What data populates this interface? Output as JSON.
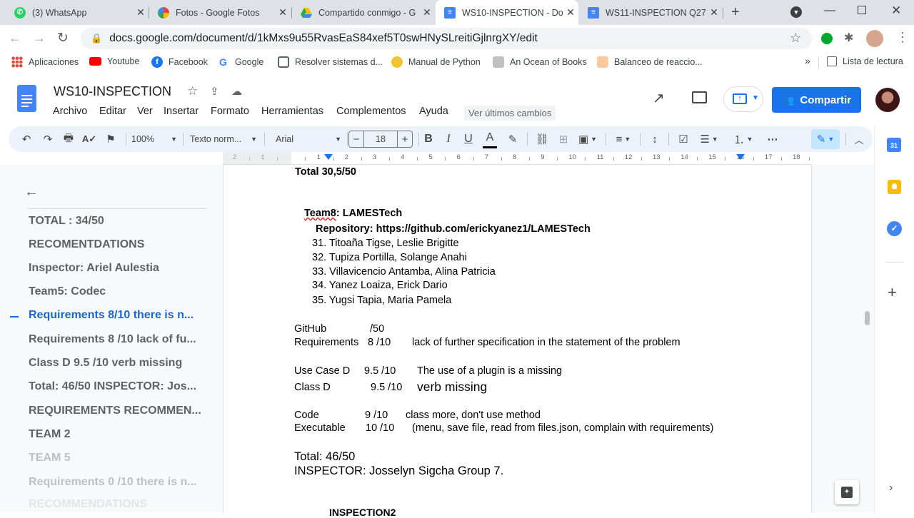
{
  "browser": {
    "tabs": [
      {
        "title": "(3) WhatsApp",
        "icon": "whatsapp-icon",
        "color": "#25d366"
      },
      {
        "title": "Fotos - Google Fotos",
        "icon": "google-photos-icon",
        "color": "#fbbc04"
      },
      {
        "title": "Compartido conmigo - G",
        "icon": "google-drive-icon",
        "color": "#1a73e8"
      },
      {
        "title": "WS10-INSPECTION - Do",
        "icon": "google-docs-icon",
        "color": "#4285f4"
      },
      {
        "title": "WS11-INSPECTION Q27",
        "icon": "google-docs-icon",
        "color": "#4285f4"
      }
    ],
    "url": "docs.google.com/document/d/1kMxs9u55RvasEaS84xef5T0swHNySLreitiGjlnrgXY/edit",
    "bookmarks": [
      "Aplicaciones",
      "Youtube",
      "Facebook",
      "Google",
      "Resolver sistemas d...",
      "Manual de Python",
      "An Ocean of Books",
      "Balanceo de reaccio..."
    ],
    "bookmarks_overflow": "»",
    "reading_list": "Lista de lectura"
  },
  "doc": {
    "title": "WS10-INSPECTION",
    "menu": [
      "Archivo",
      "Editar",
      "Ver",
      "Insertar",
      "Formato",
      "Herramientas",
      "Complementos",
      "Ayuda"
    ],
    "last_edit": "Ver últimos cambios",
    "share_label": "Compartir"
  },
  "toolbar": {
    "zoom": "100%",
    "style": "Texto norm...",
    "font": "Arial",
    "font_size": "18",
    "minus": "−",
    "plus": "+",
    "bold": "B",
    "italic": "I",
    "underline": "U",
    "text_color_letter": "A"
  },
  "ruler": [
    "2",
    "1",
    "",
    "1",
    "2",
    "3",
    "4",
    "5",
    "6",
    "7",
    "8",
    "9",
    "10",
    "11",
    "12",
    "13",
    "14",
    "15",
    "16",
    "17",
    "18"
  ],
  "outline": {
    "items": [
      {
        "text": "TOTAL : 34/50",
        "active": false,
        "muted": false
      },
      {
        "text": "RECOMENTDATIONS",
        "active": false,
        "muted": false
      },
      {
        "text": "Inspector: Ariel Aulestia",
        "active": false,
        "muted": false
      },
      {
        "text": "Team5: Codec",
        "active": false,
        "muted": false
      },
      {
        "text": "Requirements 8/10 there is n...",
        "active": true,
        "muted": false
      },
      {
        "text": "Requirements 8 /10 lack of fu...",
        "active": false,
        "muted": false
      },
      {
        "text": "Class D 9.5 /10 verb missing",
        "active": false,
        "muted": false
      },
      {
        "text": "Total: 46/50 INSPECTOR: Jos...",
        "active": false,
        "muted": false
      },
      {
        "text": "REQUIREMENTS RECOMMEN...",
        "active": false,
        "muted": false
      },
      {
        "text": "TEAM 2",
        "active": false,
        "muted": false
      },
      {
        "text": "TEAM 5",
        "active": false,
        "muted": true
      },
      {
        "text": "Requirements 0 /10 there is n...",
        "active": false,
        "muted": true
      },
      {
        "text": "RECOMMENDATIONS",
        "active": false,
        "muted": true
      }
    ]
  },
  "page": {
    "total_top": "Total 30,5/50",
    "team_label": "Team8",
    "team_rest": ": LAMESTech",
    "repo": "Repository: https://github.com/erickyanez1/LAMESTech",
    "members": [
      "31. Titoaña Tigse, Leslie Brigitte",
      "32. Tupiza Portilla, Solange Anahi",
      "33. Villavicencio Antamba, Alina Patricia",
      "34. Yanez Loaiza, Erick Dario",
      "35. Yugsi Tapia, Maria Pamela"
    ],
    "scores": {
      "github": {
        "label": "GitHub",
        "score": "/50",
        "note": ""
      },
      "requirements": {
        "label": "Requirements",
        "score": "8 /10",
        "note": "lack of further specification in the statement of the problem"
      },
      "use_case": {
        "label": "Use Case D",
        "score": "9.5  /10",
        "note": "The use of a plugin is a missing"
      },
      "class_d": {
        "label": "Class D",
        "score": "9.5 /10",
        "note": "verb missing"
      },
      "code": {
        "label": "Code",
        "score": "9  /10",
        "note": "class more, don't use method"
      },
      "executable": {
        "label": "Executable",
        "score": "10  /10",
        "note": "(menu, save file, read from files.json, complain with requirements)"
      }
    },
    "total": "Total: 46/50",
    "inspector": "INSPECTOR: Josselyn Sigcha Group 7.",
    "next_heading": "INSPECTION2"
  }
}
